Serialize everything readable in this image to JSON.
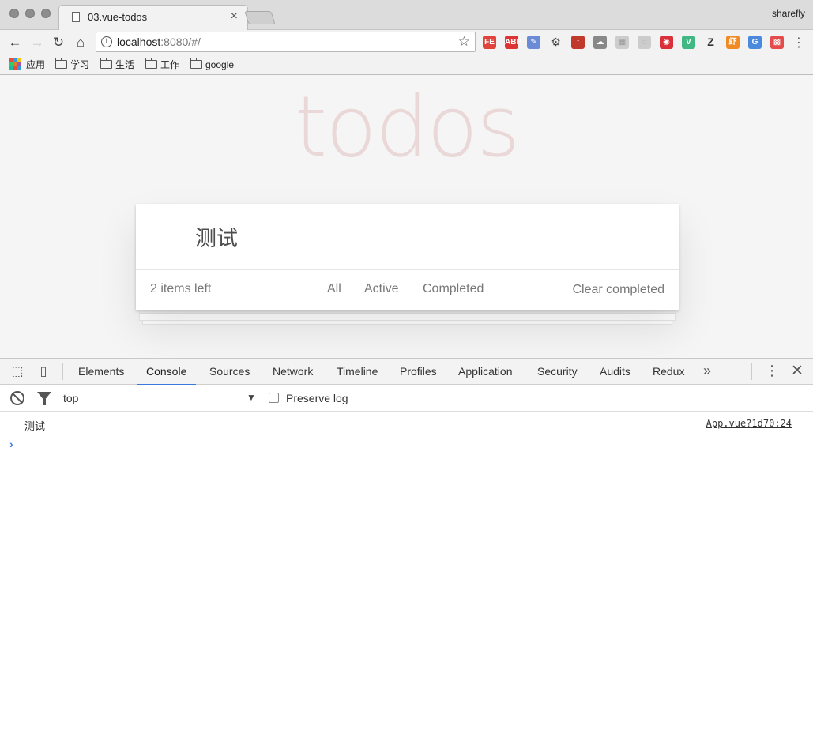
{
  "browser": {
    "tab_title": "03.vue-todos",
    "tab_close": "×",
    "profile_name": "sharefly",
    "url_host": "localhost",
    "url_rest": ":8080/#/",
    "nav": {
      "back": "←",
      "forward": "→",
      "reload": "↻",
      "home": "⌂"
    },
    "extensions": [
      {
        "label": "FE",
        "color": "#e0433b"
      },
      {
        "label": "ABP",
        "color": "#d33"
      },
      {
        "label": "✎",
        "color": "#6b8bd6"
      },
      {
        "label": "⚙",
        "color": "#444"
      },
      {
        "label": "↑",
        "color": "#c0392b"
      },
      {
        "label": "☁",
        "color": "#888"
      },
      {
        "label": "▦",
        "color": "#ccc"
      },
      {
        "label": "◌",
        "color": "#ccc"
      },
      {
        "label": "◉",
        "color": "#d9303a"
      },
      {
        "label": "V",
        "color": "#41b883"
      },
      {
        "label": "Z",
        "color": "#333"
      },
      {
        "label": "虾",
        "color": "#f08a24"
      },
      {
        "label": "G",
        "color": "#4a89dc"
      },
      {
        "label": "▩",
        "color": "#e54b4b"
      }
    ],
    "bookmarks": [
      "应用",
      "学习",
      "生活",
      "工作",
      "google"
    ]
  },
  "page": {
    "app_title": "todos",
    "new_todo_value": "测试",
    "items_left": "2 items left",
    "filters": [
      "All",
      "Active",
      "Completed"
    ],
    "clear_completed": "Clear completed"
  },
  "devtools": {
    "tabs": [
      "Elements",
      "Console",
      "Sources",
      "Network",
      "Timeline",
      "Profiles",
      "Application",
      "Security",
      "Audits",
      "Redux"
    ],
    "active_tab": "Console",
    "more": "»",
    "kebab": "⋮",
    "close": "✕",
    "context": "top",
    "context_arrow": "▼",
    "preserve_log": "Preserve log",
    "log_message": "测试",
    "log_source": "App.vue?1d70:24",
    "prompt": "›"
  },
  "colors": {
    "accent": "#3879d9",
    "title": "rgba(175,47,47,0.15)"
  }
}
